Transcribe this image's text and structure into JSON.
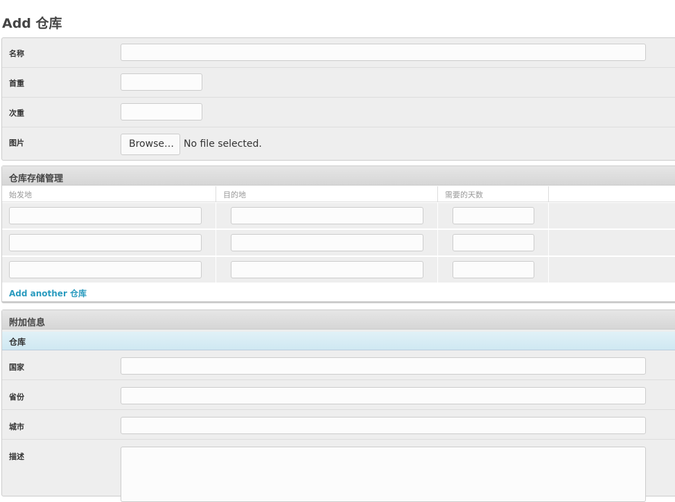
{
  "page": {
    "title": "Add 仓库"
  },
  "basic": {
    "fields": [
      {
        "label": "名称"
      },
      {
        "label": "首重"
      },
      {
        "label": "次重"
      },
      {
        "label": "图片"
      }
    ],
    "browse_label": "Browse…",
    "no_file": "No file selected."
  },
  "storage": {
    "title": "仓库存储管理",
    "columns": [
      "始发地",
      "目的地",
      "需要的天数"
    ],
    "row_count": 3,
    "add_another": "Add another 仓库"
  },
  "extra": {
    "title": "附加信息",
    "subtitle": "仓库",
    "fields": [
      {
        "label": "国家"
      },
      {
        "label": "省份"
      },
      {
        "label": "城市"
      },
      {
        "label": "描述"
      }
    ]
  },
  "colors": {
    "link": "#2a9bbf",
    "subheader": "#d9edf5"
  }
}
